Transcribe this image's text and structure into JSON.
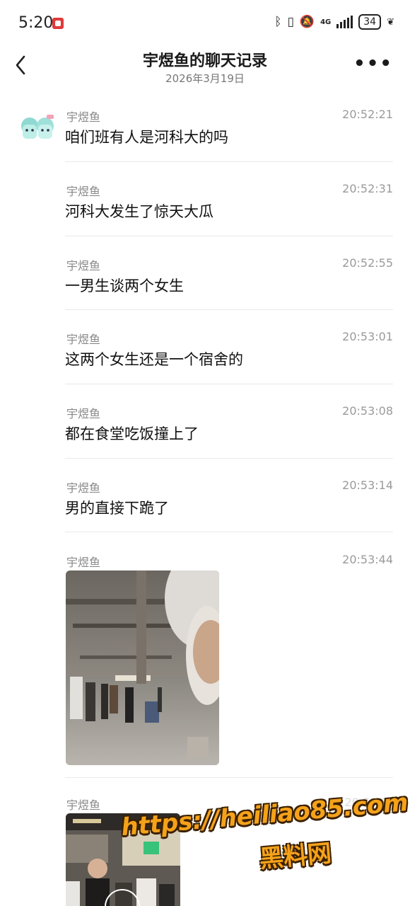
{
  "status_bar": {
    "time": "5:20",
    "network": "4G",
    "battery": "34"
  },
  "header": {
    "title": "宇煜鱼的聊天记录",
    "date": "2026年3月19日"
  },
  "messages": [
    {
      "sender": "宇煜鱼",
      "time": "20:52:21",
      "text": "咱们班有人是河科大的吗"
    },
    {
      "sender": "宇煜鱼",
      "time": "20:52:31",
      "text": "河科大发生了惊天大瓜"
    },
    {
      "sender": "宇煜鱼",
      "time": "20:52:55",
      "text": "一男生谈两个女生"
    },
    {
      "sender": "宇煜鱼",
      "time": "20:53:01",
      "text": "这两个女生还是一个宿舍的"
    },
    {
      "sender": "宇煜鱼",
      "time": "20:53:08",
      "text": "都在食堂吃饭撞上了"
    },
    {
      "sender": "宇煜鱼",
      "time": "20:53:14",
      "text": "男的直接下跪了"
    },
    {
      "sender": "宇煜鱼",
      "time": "20:53:44",
      "text": ""
    },
    {
      "sender": "宇煜鱼",
      "time": "20:53:??",
      "text": ""
    }
  ],
  "watermark": {
    "url": "https://heiliao85.com",
    "name": "黑料网"
  }
}
